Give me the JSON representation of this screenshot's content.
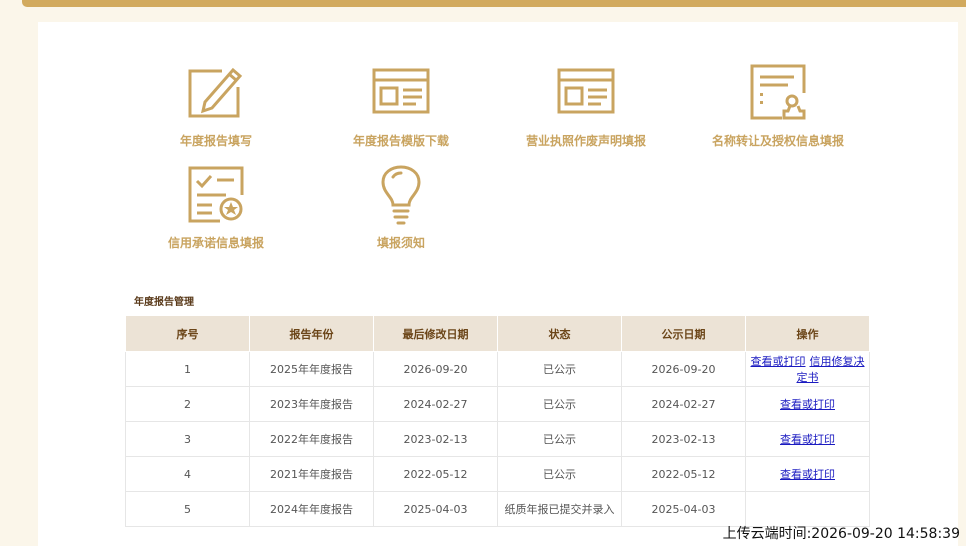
{
  "menu": [
    {
      "label": "年度报告填写",
      "icon": "pencil-edit-icon"
    },
    {
      "label": "年度报告模版下载",
      "icon": "template-document-icon"
    },
    {
      "label": "营业执照作废声明填报",
      "icon": "license-document-icon"
    },
    {
      "label": "名称转让及授权信息填报",
      "icon": "certificate-stamp-icon"
    },
    {
      "label": "信用承诺信息填报",
      "icon": "checklist-badge-icon"
    },
    {
      "label": "填报须知",
      "icon": "lightbulb-icon"
    }
  ],
  "section_title": "年度报告管理",
  "table": {
    "headers": [
      "序号",
      "报告年份",
      "最后修改日期",
      "状态",
      "公示日期",
      "操作"
    ],
    "rows": [
      {
        "no": "1",
        "year": "2025年年度报告",
        "modified": "2026-09-20",
        "status": "已公示",
        "published": "2026-09-20",
        "actions": [
          "查看或打印",
          "信用修复决定书"
        ]
      },
      {
        "no": "2",
        "year": "2023年年度报告",
        "modified": "2024-02-27",
        "status": "已公示",
        "published": "2024-02-27",
        "actions": [
          "查看或打印"
        ]
      },
      {
        "no": "3",
        "year": "2022年年度报告",
        "modified": "2023-02-13",
        "status": "已公示",
        "published": "2023-02-13",
        "actions": [
          "查看或打印"
        ]
      },
      {
        "no": "4",
        "year": "2021年年度报告",
        "modified": "2022-05-12",
        "status": "已公示",
        "published": "2022-05-12",
        "actions": [
          "查看或打印"
        ]
      },
      {
        "no": "5",
        "year": "2024年年度报告",
        "modified": "2025-04-03",
        "status": "纸质年报已提交并录入",
        "published": "2025-04-03",
        "actions": []
      }
    ]
  },
  "footer": "上传云端时间:2026-09-20 14:58:39",
  "colors": {
    "accent": "#c9a460",
    "topbar": "#d2aa5e",
    "header_bg": "#ece3d6",
    "link": "#1b1bc1"
  }
}
